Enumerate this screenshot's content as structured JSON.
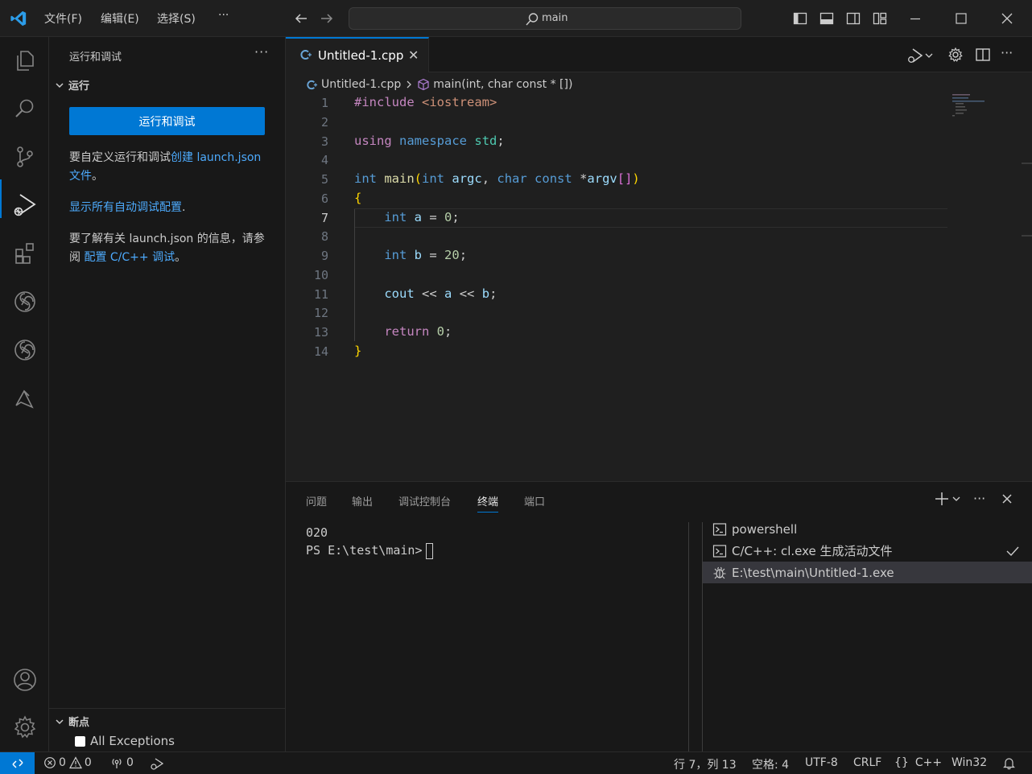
{
  "menu": {
    "file": "文件(F)",
    "edit": "编辑(E)",
    "select": "选择(S)",
    "more": "···"
  },
  "search": {
    "label": "main"
  },
  "sidebar": {
    "title": "运行和调试",
    "more": "···",
    "run_section": "运行",
    "run_button": "运行和调试",
    "para1_prefix": "要自定义运行和调试",
    "para1_link": "创建 launch.json 文件",
    "para1_suffix": "。",
    "para2_link": "显示所有自动调试配置",
    "para2_suffix": ".",
    "para3_prefix": "要了解有关 launch.json 的信息，请参阅 ",
    "para3_link": "配置 C/C++ 调试",
    "para3_suffix": "。",
    "breakpoints_section": "断点",
    "breakpoint_item": "All Exceptions"
  },
  "editor": {
    "tab_name": "Untitled-1.cpp",
    "tab_close": "✕",
    "breadcrumb_file": "Untitled-1.cpp",
    "breadcrumb_symbol": "main(int, char const * [])",
    "line_numbers": [
      "1",
      "2",
      "3",
      "4",
      "5",
      "6",
      "7",
      "8",
      "9",
      "10",
      "11",
      "12",
      "13",
      "14"
    ],
    "active_line": "7",
    "code": {
      "l1_pp": "#include",
      "l1_inc": "<iostream>",
      "l3_using": "using",
      "l3_namespace": "namespace",
      "l3_std": "std",
      "l3_semi": ";",
      "l5_int": "int",
      "l5_main": "main",
      "l5_open": "(",
      "l5_int2": "int",
      "l5_argc": "argc",
      "l5_comma": ",",
      "l5_char": "char",
      "l5_const": "const",
      "l5_star": "*",
      "l5_argv": "argv",
      "l5_brackets": "[]",
      "l5_close": ")",
      "l6_brace": "{",
      "l7_int": "int",
      "l7_a": "a",
      "l7_eq": "=",
      "l7_val": "0",
      "l7_semi": ";",
      "l9_int": "int",
      "l9_b": "b",
      "l9_eq": "=",
      "l9_val": "20",
      "l9_semi": ";",
      "l11_cout": "cout",
      "l11_op1": "<<",
      "l11_a": "a",
      "l11_op2": "<<",
      "l11_b": "b",
      "l11_semi": ";",
      "l13_return": "return",
      "l13_val": "0",
      "l13_semi": ";",
      "l14_brace": "}"
    }
  },
  "panel": {
    "tabs": [
      "问题",
      "输出",
      "调试控制台",
      "终端",
      "端口"
    ],
    "active_tab": "终端",
    "terminal_line1": "020",
    "terminal_prompt": "PS E:\\test\\main>",
    "terminals": [
      {
        "label": "powershell"
      },
      {
        "label": "C/C++: cl.exe 生成活动文件"
      },
      {
        "label": "E:\\test\\main\\Untitled-1.exe"
      }
    ]
  },
  "statusbar": {
    "errors": "0",
    "warnings": "0",
    "ports": "0",
    "position": "行 7，列 13",
    "spaces": "空格: 4",
    "encoding": "UTF-8",
    "eol": "CRLF",
    "language_braces": "{}",
    "language": "C++",
    "platform": "Win32"
  },
  "colors": {
    "accent": "#0078d4",
    "link": "#4daafc",
    "keyword": "#569cd6",
    "preprocessor": "#c586c0",
    "string": "#ce9178"
  }
}
